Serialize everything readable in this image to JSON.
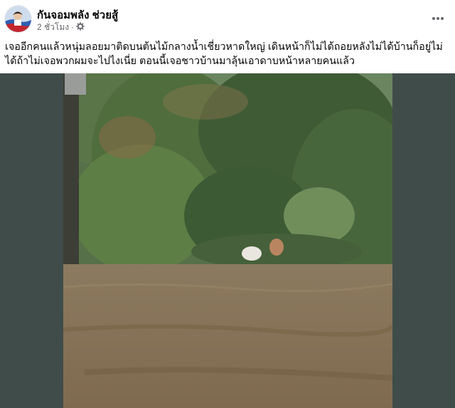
{
  "post": {
    "author": "กันจอมพลัง ช่วยสู้",
    "timestamp": "2 ชั่วโมง",
    "separator": "·",
    "audience_icon": "friends-settings-icon",
    "more_icon": "more-options-icon",
    "text": "เจออีกคนแล้วหนุ่มลอยมาติดบนต้นไม้กลางน้ำเชี่ยวหาดใหญ่ เดินหน้าก็ไม่ได้ถอยหลังไม่ได้บ้านก็อยู่ไม่ได้ถ้าไม่เจอพวกผมจะไปไงเนี่ย ตอนนี้เจอชาวบ้านมาลุ้นเอาดาบหน้าหลายคนแล้ว"
  },
  "colors": {
    "media_background": "#404c49",
    "floodwater": "#8a7458",
    "foliage": "#4a6a38",
    "text_primary": "#050505",
    "text_secondary": "#65676b"
  }
}
